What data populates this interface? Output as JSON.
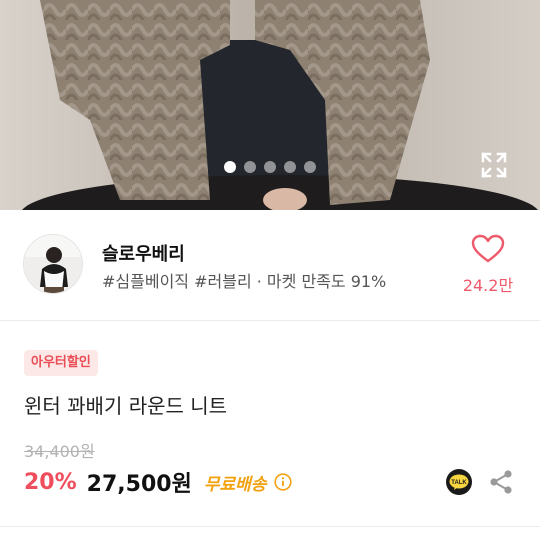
{
  "carousel": {
    "pages": 5,
    "active_index": 0
  },
  "seller": {
    "name": "슬로우베리",
    "tags": "#심플베이직 #러블리 · 마켓 만족도 91%",
    "like_count": "24.2만"
  },
  "product": {
    "badge": "아우터할인",
    "title": "윈터 꽈배기 라운드 니트",
    "original_price": "34,400원",
    "discount": "20%",
    "sale_price": "27,500원",
    "free_shipping": "무료배송"
  },
  "share": {
    "kakao_label": "TALK"
  },
  "colors": {
    "accent_red": "#ef4e5c",
    "shipping_orange": "#f2a20f",
    "heart_pink": "#ef5a6b"
  }
}
